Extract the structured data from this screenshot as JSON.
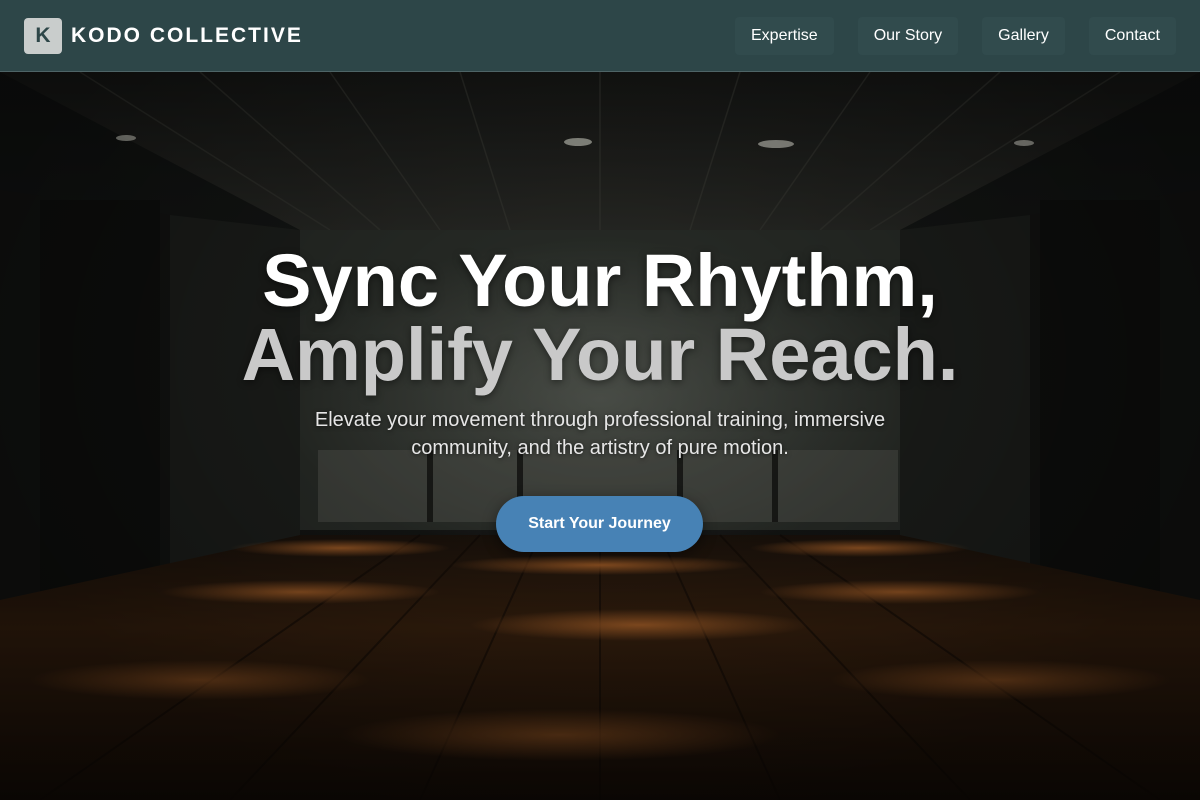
{
  "header": {
    "logo_letter": "K",
    "brand_name": "KODO COLLECTIVE",
    "nav": [
      {
        "label": "Expertise"
      },
      {
        "label": "Our Story"
      },
      {
        "label": "Gallery"
      },
      {
        "label": "Contact"
      }
    ]
  },
  "hero": {
    "headline_line1": "Sync Your Rhythm,",
    "headline_line2": "Amplify Your Reach.",
    "subtitle": "Elevate your movement through professional training, immersive community, and the artistry of pure motion.",
    "cta_label": "Start Your Journey"
  },
  "colors": {
    "header_bg": "#2d4648",
    "nav_item_bg": "#314b4d",
    "logo_mark_bg": "#c9cdcc",
    "cta_bg": "#4782b5",
    "headline_primary": "#ffffff",
    "headline_secondary": "#c9c9c9",
    "floor_accent": "#8a4a1c"
  }
}
